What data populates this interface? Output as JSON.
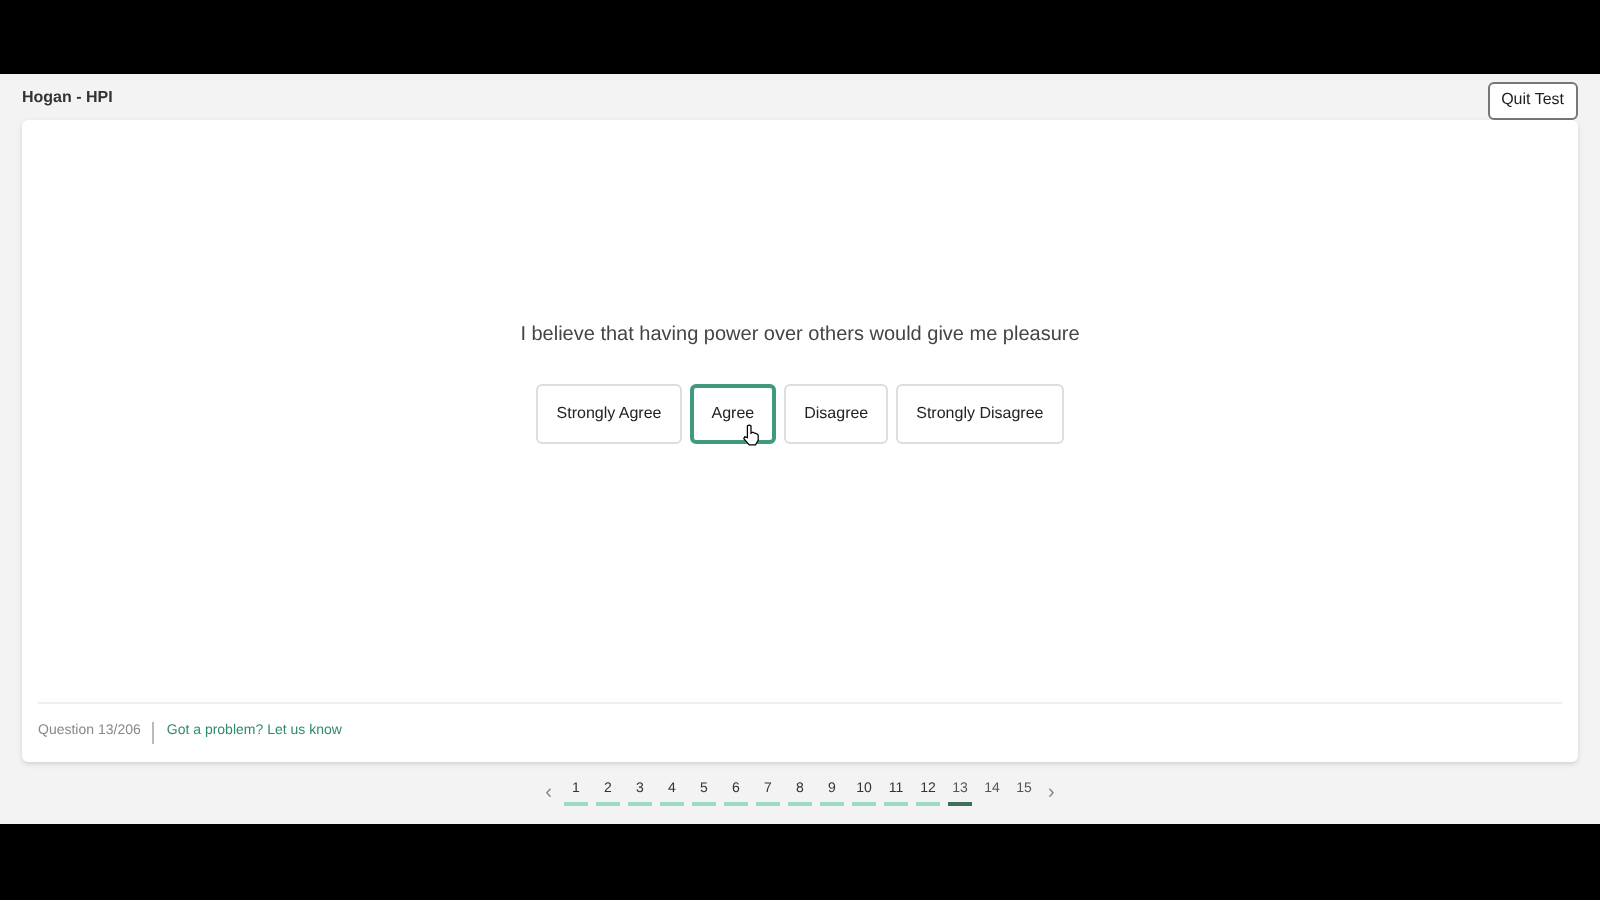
{
  "header": {
    "title": "Hogan - HPI",
    "quit_button": "Quit Test"
  },
  "question": {
    "text": "I believe that having power over others would give me pleasure",
    "options": [
      {
        "label": "Strongly Agree",
        "selected": false
      },
      {
        "label": "Agree",
        "selected": true
      },
      {
        "label": "Disagree",
        "selected": false
      },
      {
        "label": "Strongly Disagree",
        "selected": false
      }
    ]
  },
  "footer": {
    "progress": "Question 13/206",
    "help_link": "Got a problem? Let us know"
  },
  "pagination": {
    "prev": "‹",
    "next": "›",
    "pages": [
      {
        "label": "1",
        "answered": true,
        "selected": false
      },
      {
        "label": "2",
        "answered": true,
        "selected": false
      },
      {
        "label": "3",
        "answered": true,
        "selected": false
      },
      {
        "label": "4",
        "answered": true,
        "selected": false
      },
      {
        "label": "5",
        "answered": true,
        "selected": false
      },
      {
        "label": "6",
        "answered": true,
        "selected": false
      },
      {
        "label": "7",
        "answered": true,
        "selected": false
      },
      {
        "label": "8",
        "answered": true,
        "selected": false
      },
      {
        "label": "9",
        "answered": true,
        "selected": false
      },
      {
        "label": "10",
        "answered": true,
        "selected": false
      },
      {
        "label": "11",
        "answered": true,
        "selected": false
      },
      {
        "label": "12",
        "answered": true,
        "selected": false
      },
      {
        "label": "13",
        "answered": false,
        "selected": true
      },
      {
        "label": "14",
        "answered": false,
        "selected": false
      },
      {
        "label": "15",
        "answered": false,
        "selected": false
      }
    ]
  }
}
